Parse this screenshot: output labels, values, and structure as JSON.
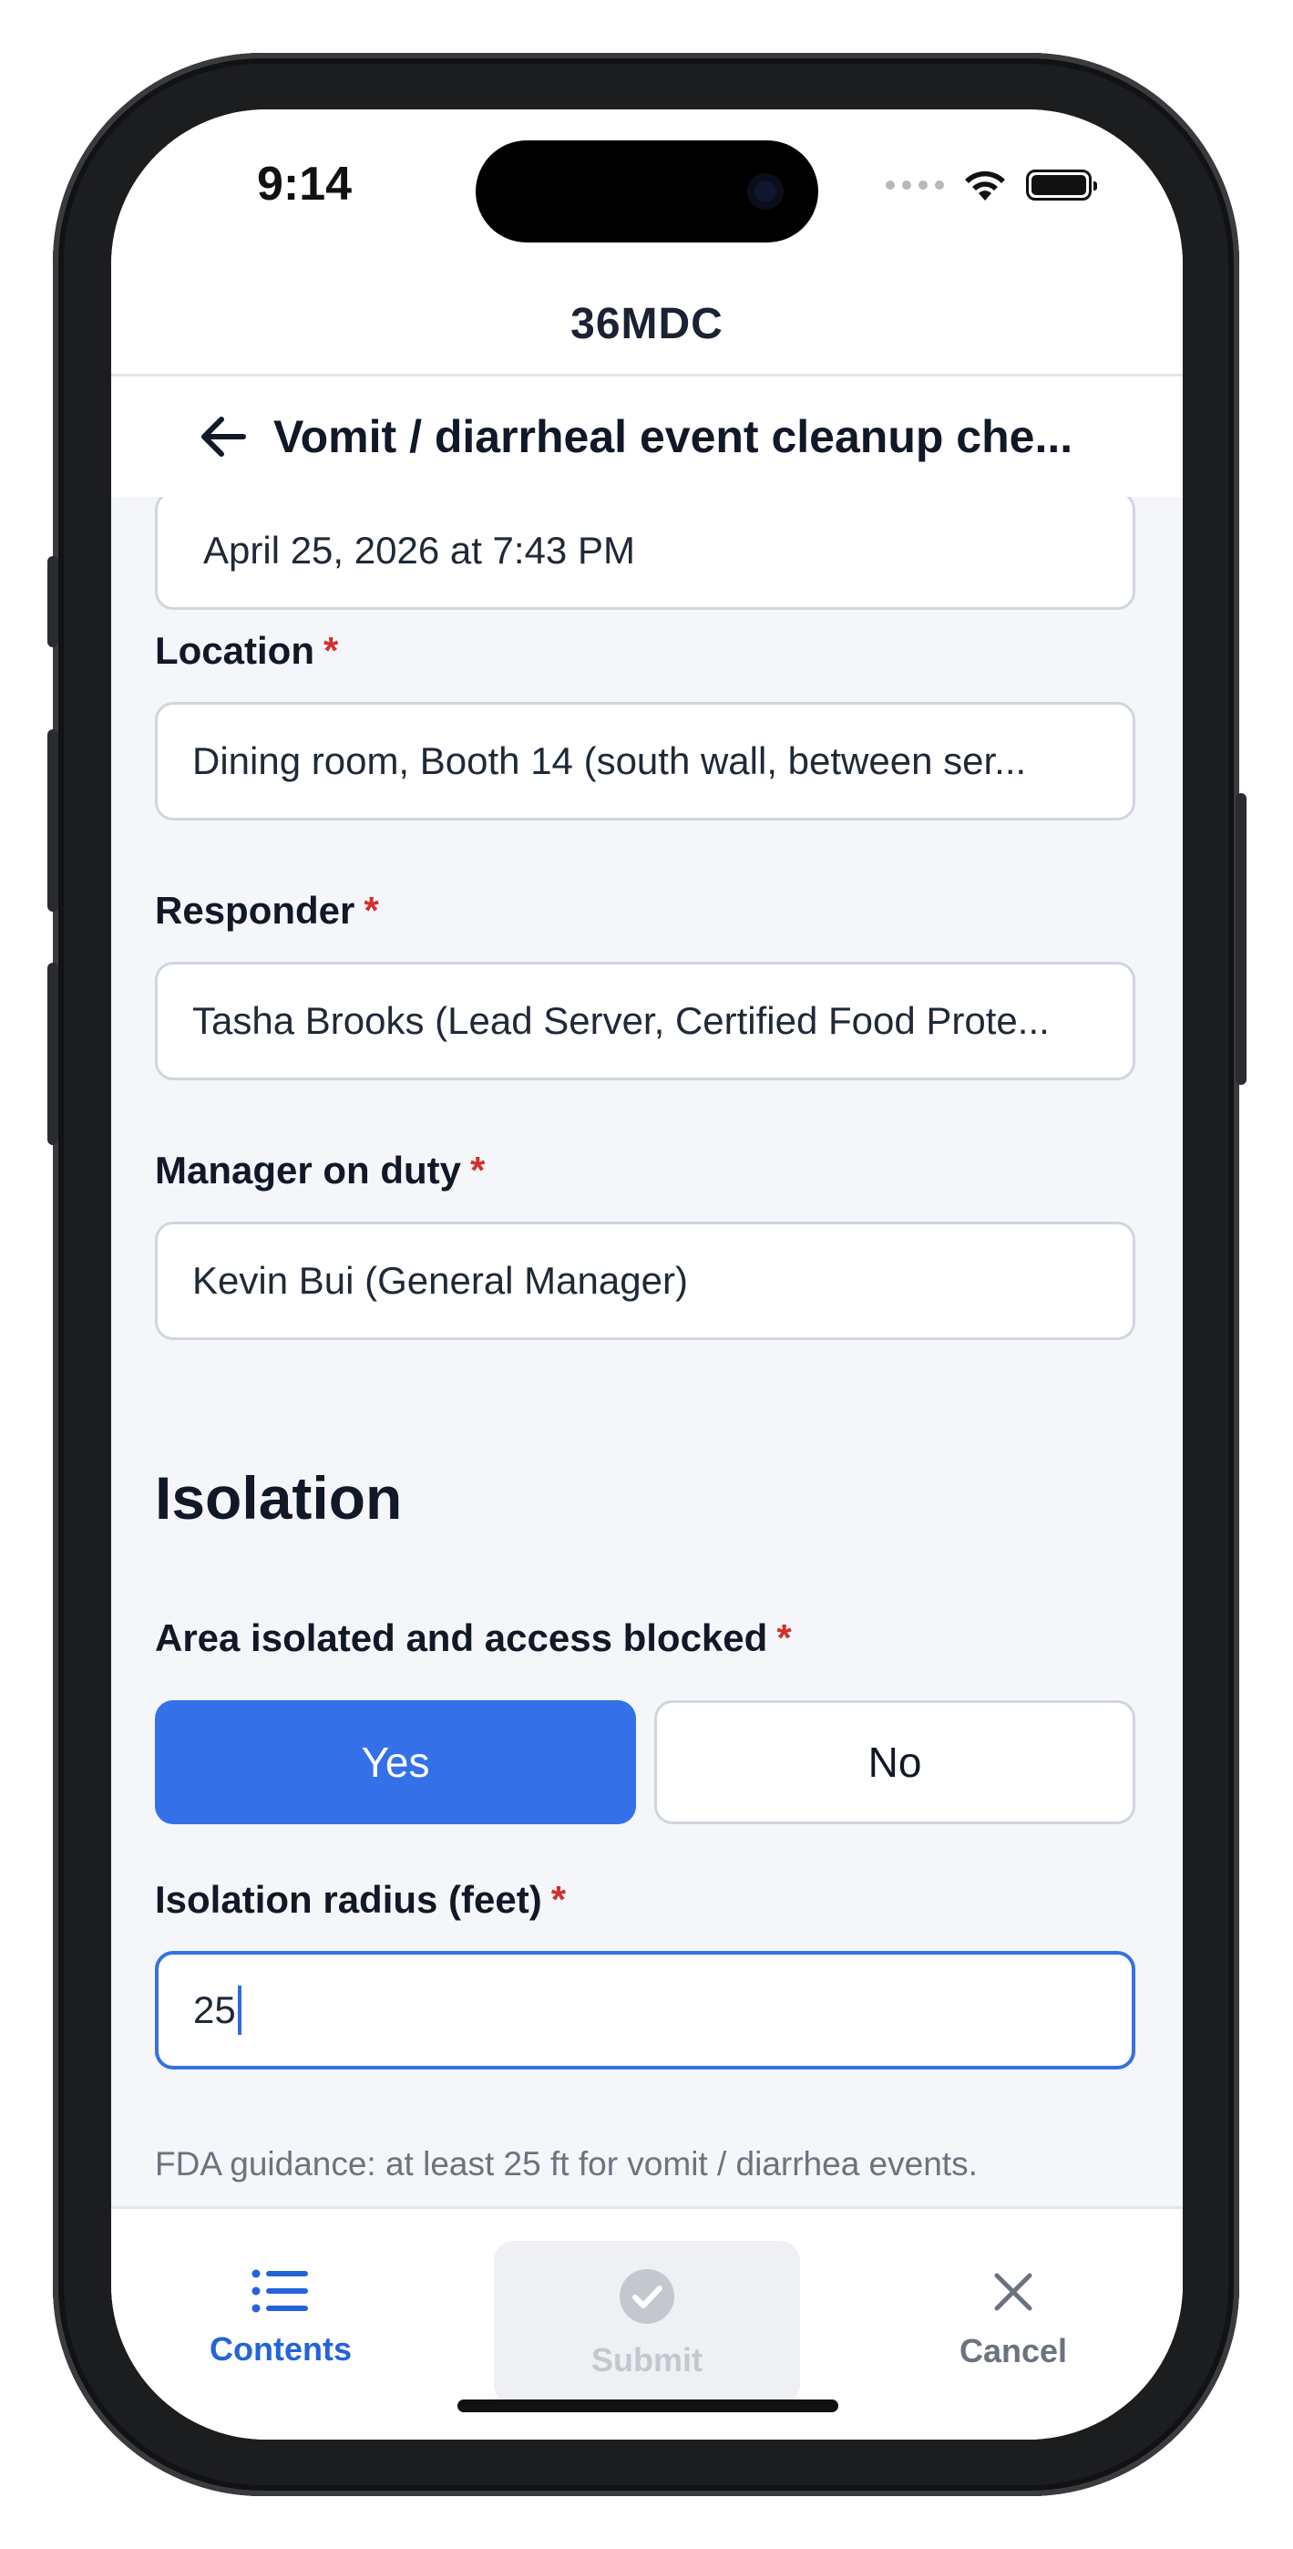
{
  "status_bar": {
    "time": "9:14"
  },
  "app": {
    "title": "36MDC"
  },
  "header": {
    "title": "Vomit / diarrheal event cleanup che..."
  },
  "form": {
    "datetime_value": "April 25, 2026 at 7:43 PM",
    "location": {
      "label": "Location",
      "required_mark": "*",
      "value": "Dining room, Booth 14 (south wall, between ser..."
    },
    "responder": {
      "label": "Responder",
      "required_mark": "*",
      "value": "Tasha Brooks (Lead Server, Certified Food Prote..."
    },
    "manager": {
      "label": "Manager on duty",
      "required_mark": "*",
      "value": "Kevin Bui (General Manager)"
    },
    "isolation": {
      "section_title": "Isolation",
      "area_isolated": {
        "label": "Area isolated and access blocked",
        "required_mark": "*",
        "yes": "Yes",
        "no": "No",
        "selected": "Yes"
      },
      "radius": {
        "label": "Isolation radius (feet)",
        "required_mark": "*",
        "value": "25",
        "helper": "FDA guidance: at least 25 ft for vomit / diarrhea events."
      }
    }
  },
  "bottom_bar": {
    "contents": "Contents",
    "submit": "Submit",
    "cancel": "Cancel"
  },
  "colors": {
    "accent": "#3471e8",
    "required": "#d32f2f"
  }
}
